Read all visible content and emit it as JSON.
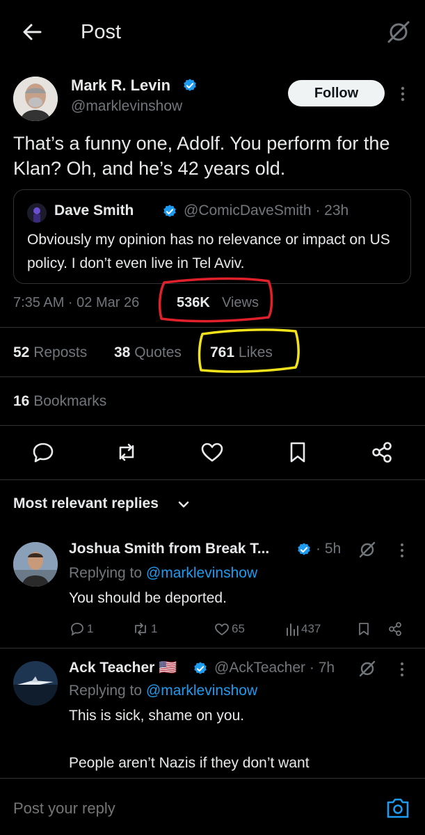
{
  "header": {
    "title": "Post",
    "back_icon": "arrow-left-icon",
    "grok_icon": "grok-icon"
  },
  "post": {
    "author_name": "Mark R. Levin",
    "author_handle": "@marklevinshow",
    "follow_label": "Follow",
    "text": "That’s a funny one, Adolf. You perform for the Klan?  Oh, and he’s 42 years old.",
    "quote": {
      "author_name": "Dave Smith",
      "author_handle": "@ComicDaveSmith",
      "time": "23h",
      "meta": "@ComicDaveSmith · 23h",
      "text": "Obviously my opinion has no relevance or impact on US policy. I don’t even live in Tel Aviv."
    },
    "timestamp": "7:35 AM · 02 Mar 26",
    "views_count": "536K",
    "views_label": "Views",
    "stats": {
      "reposts_count": "52",
      "reposts_label": "Reposts",
      "quotes_count": "38",
      "quotes_label": "Quotes",
      "likes_count": "761",
      "likes_label": "Likes",
      "bookmarks_count": "16",
      "bookmarks_label": "Bookmarks"
    },
    "annotation_colors": {
      "views_circle": "#e0202a",
      "likes_circle": "#f2e21b"
    }
  },
  "replies_header": "Most relevant replies",
  "replies": [
    {
      "name": "Joshua Smith from Break T...",
      "meta": "· 5h",
      "replying_prefix": "Replying to",
      "replying_handle": "@marklevinshow",
      "text": "You should be deported.",
      "counts": {
        "replies": "1",
        "reposts": "1",
        "likes": "65",
        "views": "437"
      }
    },
    {
      "name": "Ack Teacher",
      "flag": "🇺🇸",
      "meta": "@AckTeacher · 7h",
      "replying_prefix": "Replying to",
      "replying_handle": "@marklevinshow",
      "text": "This is sick, shame on you.\n\nPeople aren’t Nazis if they don’t want"
    }
  ],
  "composer": {
    "placeholder": "Post your reply"
  },
  "colors": {
    "accent": "#1d9bf0",
    "muted": "#71767b",
    "background": "#000000"
  }
}
